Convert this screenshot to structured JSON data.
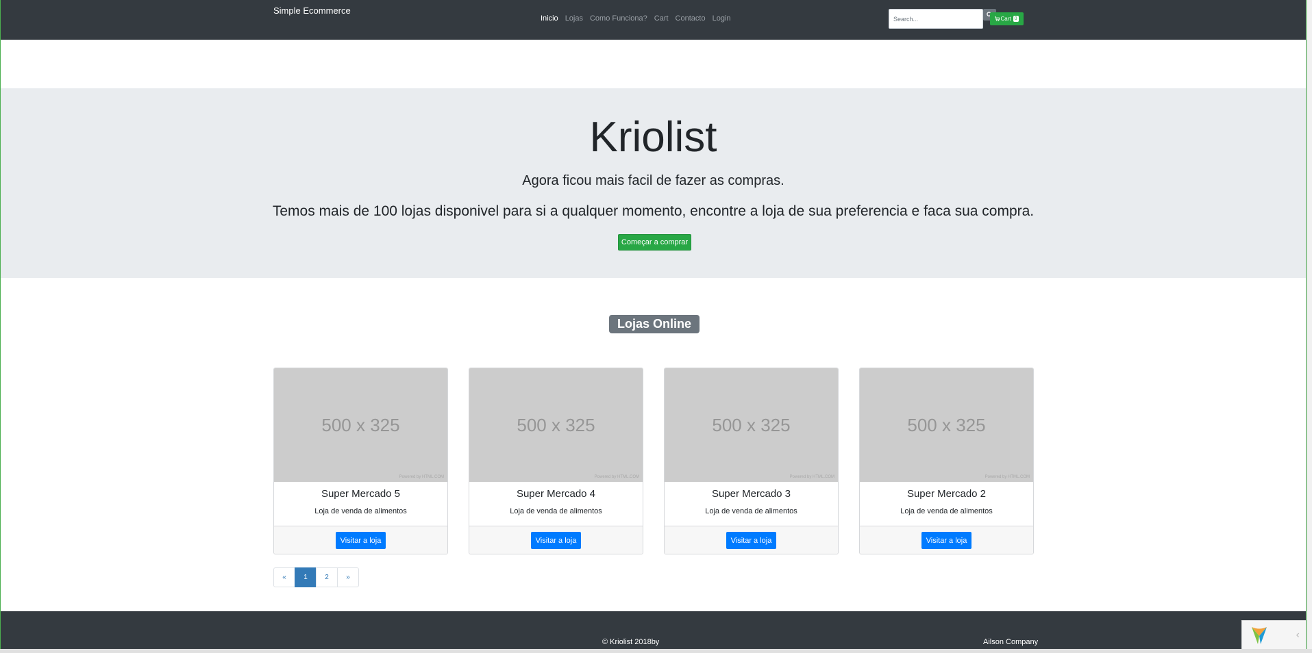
{
  "navbar": {
    "brand": "Simple Ecommerce",
    "links": [
      {
        "label": "Inicio",
        "active": true
      },
      {
        "label": "Lojas",
        "active": false
      },
      {
        "label": "Como Funciona?",
        "active": false
      },
      {
        "label": "Cart",
        "active": false
      },
      {
        "label": "Contacto",
        "active": false
      },
      {
        "label": "Login",
        "active": false
      }
    ],
    "search_placeholder": "Search...",
    "search_icon": "search-icon",
    "cart_label": "Cart",
    "cart_count": "0",
    "cart_icon": "cart-icon"
  },
  "hero": {
    "title": "Kriolist",
    "lead": "Agora ficou mais facil de fazer as compras.",
    "sub": "Temos mais de 100 lojas disponivel para si a qualquer momento, encontre a loja de sua preferencia e faca sua compra.",
    "button": "Começar a comprar"
  },
  "section": {
    "title": "Lojas Online"
  },
  "cards": [
    {
      "image_text": "500 x 325",
      "image_credit": "Powered by HTML.COM",
      "title": "Super Mercado 5",
      "text": "Loja de venda de alimentos",
      "button": "Visitar a loja"
    },
    {
      "image_text": "500 x 325",
      "image_credit": "Powered by HTML.COM",
      "title": "Super Mercado 4",
      "text": "Loja de venda de alimentos",
      "button": "Visitar a loja"
    },
    {
      "image_text": "500 x 325",
      "image_credit": "Powered by HTML.COM",
      "title": "Super Mercado 3",
      "text": "Loja de venda de alimentos",
      "button": "Visitar a loja"
    },
    {
      "image_text": "500 x 325",
      "image_credit": "Powered by HTML.COM",
      "title": "Super Mercado 2",
      "text": "Loja de venda de alimentos",
      "button": "Visitar a loja"
    }
  ],
  "pagination": {
    "prev": "«",
    "pages": [
      "1",
      "2"
    ],
    "current": "1",
    "next": "»"
  },
  "footer": {
    "copyright": "© Kriolist 2018by",
    "company": "Ailson Company"
  },
  "colors": {
    "navbar_bg": "#343a40",
    "success": "#28a745",
    "primary": "#007bff",
    "jumbotron_bg": "#e9ecef",
    "badge_bg": "#6c757d"
  }
}
